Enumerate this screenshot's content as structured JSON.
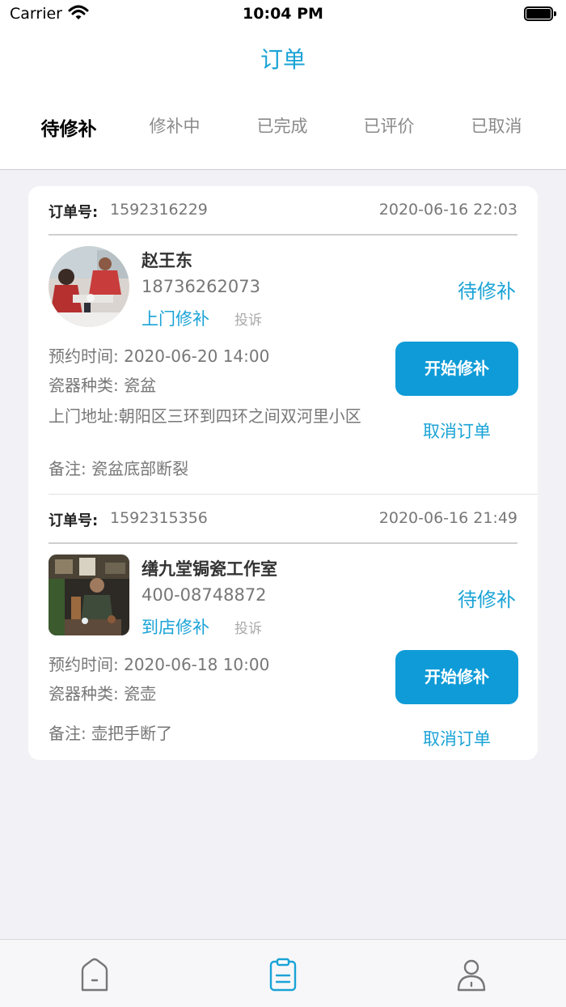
{
  "status_bar": {
    "carrier": "Carrier",
    "time": "10:04 PM"
  },
  "header": {
    "title": "订单"
  },
  "tabs": [
    {
      "label": "待修补",
      "active": true
    },
    {
      "label": "修补中",
      "active": false
    },
    {
      "label": "已完成",
      "active": false
    },
    {
      "label": "已评价",
      "active": false
    },
    {
      "label": "已取消",
      "active": false
    }
  ],
  "orders": [
    {
      "order_no_label": "订单号:",
      "order_no": "1592316229",
      "created": "2020-06-16 22:03",
      "customer": "赵王东",
      "phone": "18736262073",
      "service": "上门修补",
      "complain": "投诉",
      "status": "待修补",
      "appointment_label": "预约时间:",
      "appointment": "2020-06-20 14:00",
      "type_label": "瓷器种类:",
      "type": "瓷盆",
      "address_label": "上门地址:",
      "address": "朝阳区三环到四环之间双河里小区",
      "note_label": "备注:",
      "note": "瓷盆底部断裂",
      "start_label": "开始修补",
      "cancel_label": "取消订单"
    },
    {
      "order_no_label": "订单号:",
      "order_no": "1592315356",
      "created": "2020-06-16 21:49",
      "customer": "缮九堂锔瓷工作室",
      "phone": "400-08748872",
      "service": "到店修补",
      "complain": "投诉",
      "status": "待修补",
      "appointment_label": "预约时间:",
      "appointment": "2020-06-18 10:00",
      "type_label": "瓷器种类:",
      "type": "瓷壶",
      "note_label": "备注:",
      "note": "壶把手断了",
      "start_label": "开始修补",
      "cancel_label": "取消订单"
    }
  ],
  "tabbar": {
    "items": [
      "home-icon",
      "orders-icon",
      "profile-icon"
    ],
    "active": "orders-icon"
  },
  "colors": {
    "accent": "#1aa3d6",
    "button": "#0f9bd7",
    "background": "#f2f2f6"
  }
}
